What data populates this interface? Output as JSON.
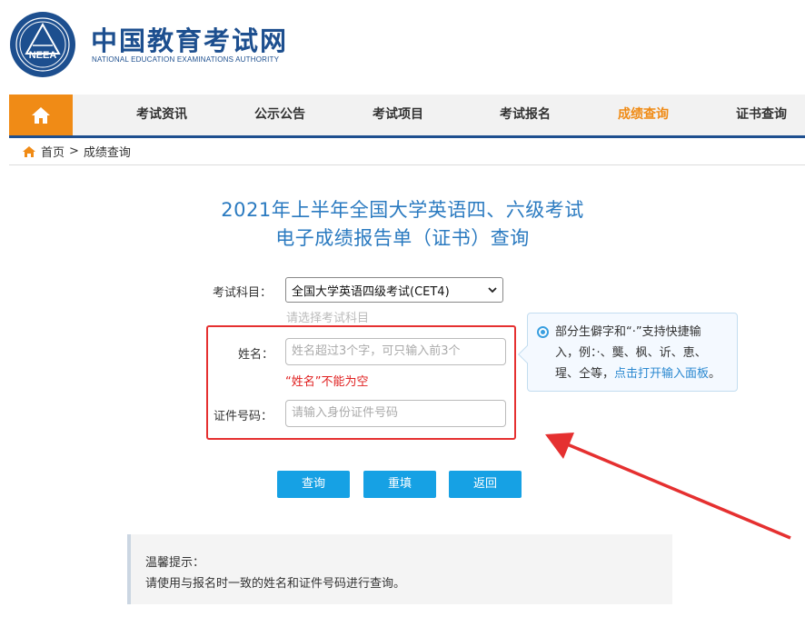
{
  "header": {
    "title": "中国教育考试网",
    "subtitle": "NATIONAL EDUCATION EXAMINATIONS AUTHORITY",
    "logo_text": "NEEA"
  },
  "nav": {
    "items": [
      {
        "label": "考试资讯"
      },
      {
        "label": "公示公告"
      },
      {
        "label": "考试项目"
      },
      {
        "label": "考试报名"
      },
      {
        "label": "成绩查询",
        "active": true
      },
      {
        "label": "证书查询"
      }
    ]
  },
  "breadcrumb": {
    "home": "首页",
    "separator": ">",
    "current": "成绩查询"
  },
  "page": {
    "title_line1": "2021年上半年全国大学英语四、六级考试",
    "title_line2": "电子成绩报告单（证书）查询"
  },
  "form": {
    "subject_label": "考试科目：",
    "subject_value": "全国大学英语四级考试(CET4)",
    "subject_hint": "请选择考试科目",
    "name_label": "姓名：",
    "name_placeholder": "姓名超过3个字，可只输入前3个",
    "name_error": "“姓名”不能为空",
    "id_label": "证件号码：",
    "id_placeholder": "请输入身份证件号码"
  },
  "tooltip": {
    "line1": "部分生僻字和“·”支持快捷输",
    "line2": "入，例：·、龑、枫、䜣、恵、",
    "line3_text": "瑆、仝等，",
    "line3_link": "点击打开输入面板",
    "line3_end": "。"
  },
  "buttons": {
    "query": "查询",
    "reset": "重填",
    "back": "返回"
  },
  "notice": {
    "title": "温馨提示：",
    "text": "请使用与报名时一致的姓名和证件号码进行查询。"
  },
  "colors": {
    "brand_blue": "#1d4f8f",
    "accent_orange": "#f08b16",
    "button_blue": "#16a1e4",
    "title_blue": "#2a7ac0",
    "error_red": "#e02020",
    "annotation_red": "#e53030"
  }
}
